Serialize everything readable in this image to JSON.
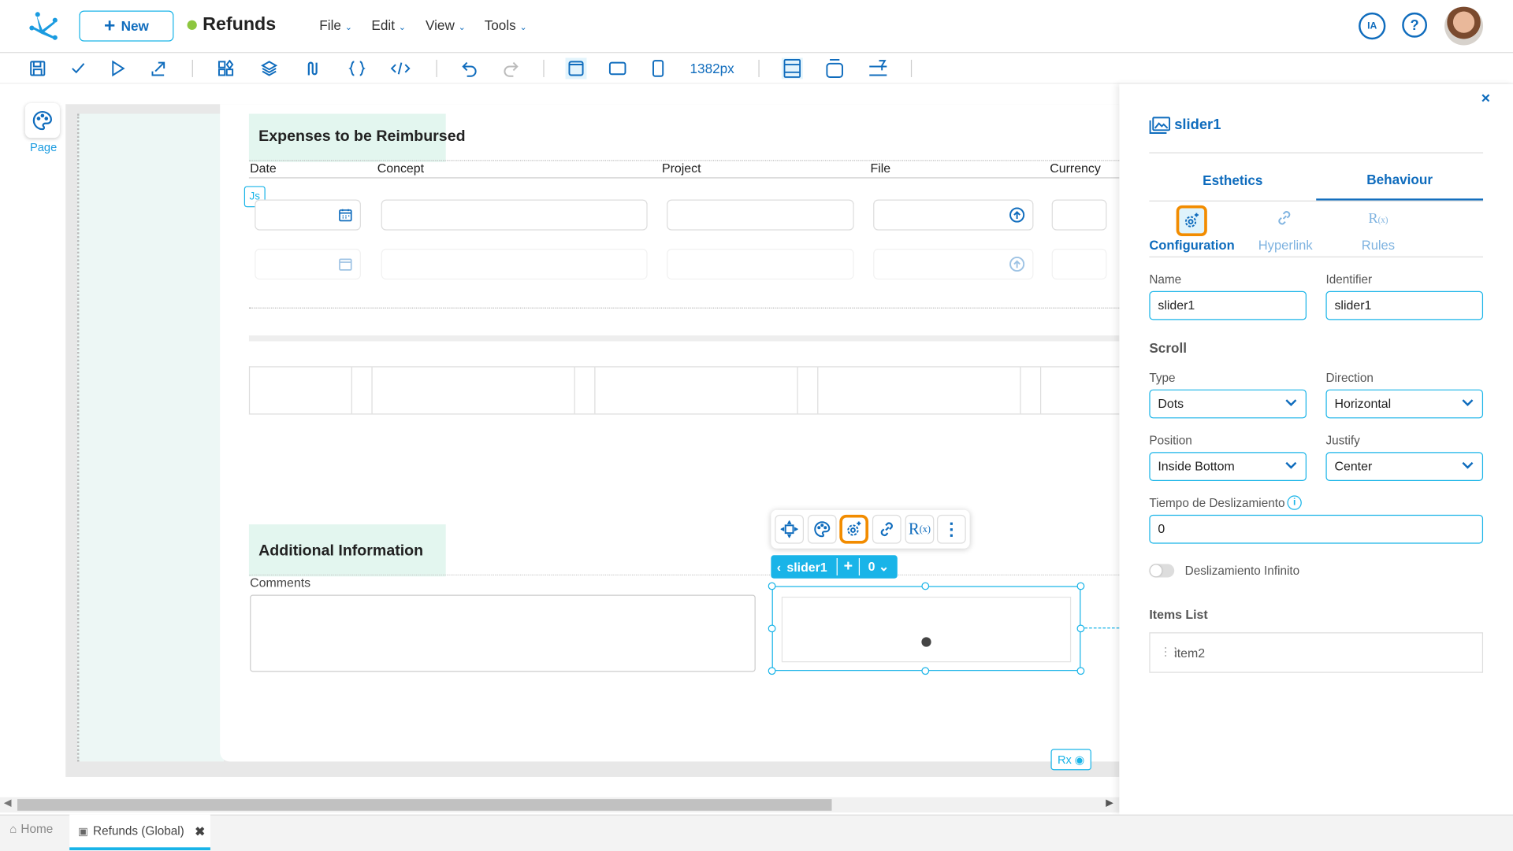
{
  "header": {
    "new_label": "New",
    "app_title": "Refunds",
    "status_color": "#8dc63f",
    "menus": [
      "File",
      "Edit",
      "View",
      "Tools"
    ],
    "ia_label": "IA"
  },
  "toolbar": {
    "width_readout": "1382px"
  },
  "left_rail": {
    "page_label": "Page"
  },
  "canvas": {
    "expenses_title": "Expenses to be Reimbursed",
    "columns": [
      "Date",
      "Concept",
      "Project",
      "File",
      "Currency"
    ],
    "js_badge": "Js",
    "additional_title": "Additional Information",
    "comments_label": "Comments",
    "selection": {
      "name": "slider1",
      "index": "0"
    },
    "rx_badge": "Rx"
  },
  "panel": {
    "title": "slider1",
    "tabs": [
      "Esthetics",
      "Behaviour"
    ],
    "active_tab": "Behaviour",
    "subtabs": [
      "Configuration",
      "Hyperlink",
      "Rules"
    ],
    "active_subtab": "Configuration",
    "name_label": "Name",
    "name_value": "slider1",
    "identifier_label": "Identifier",
    "identifier_value": "slider1",
    "scroll_heading": "Scroll",
    "type_label": "Type",
    "type_value": "Dots",
    "direction_label": "Direction",
    "direction_value": "Horizontal",
    "position_label": "Position",
    "position_value": "Inside Bottom",
    "justify_label": "Justify",
    "justify_value": "Center",
    "tiempo_label": "Tiempo de Deslizamiento",
    "tiempo_value": "0",
    "infinite_label": "Deslizamiento Infinito",
    "infinite_on": false,
    "items_heading": "Items List",
    "items": [
      "item2"
    ]
  },
  "bottom_tabs": {
    "home": "Home",
    "active": "Refunds (Global)"
  },
  "colors": {
    "accent": "#0f6cbd",
    "selection": "#19b4e8",
    "highlight": "#f28c00"
  }
}
